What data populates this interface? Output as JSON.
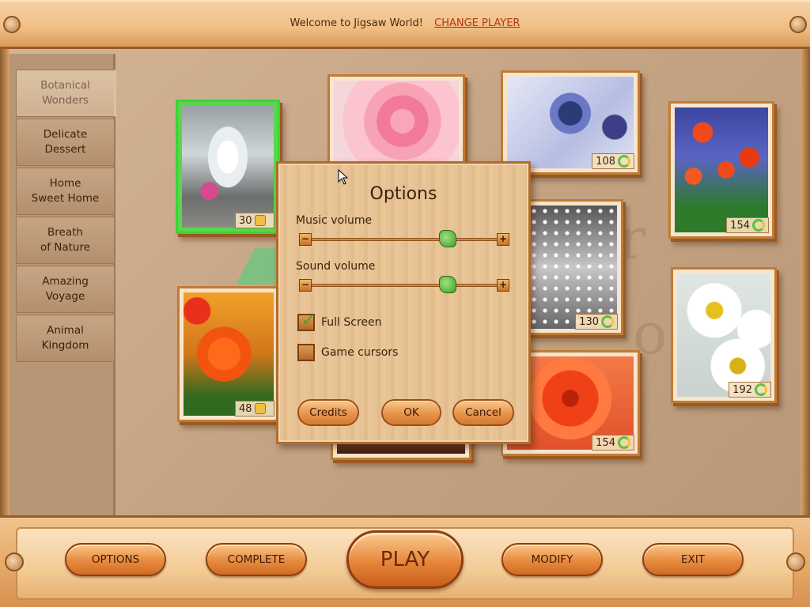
{
  "header": {
    "welcome": "Welcome to Jigsaw World!",
    "change_player": "CHANGE PLAYER"
  },
  "sidebar": {
    "items": [
      {
        "label": "Botanical\nWonders",
        "active": true
      },
      {
        "label": "Delicate\nDessert",
        "active": false
      },
      {
        "label": "Home\nSweet Home",
        "active": false
      },
      {
        "label": "Breath\nof Nature",
        "active": false
      },
      {
        "label": "Amazing\nVoyage",
        "active": false
      },
      {
        "label": "Animal\nKingdom",
        "active": false
      }
    ]
  },
  "puzzles": [
    {
      "id": "floating-candles",
      "pieces": "30",
      "selected": true
    },
    {
      "id": "pink-rose",
      "pieces": "",
      "selected": false
    },
    {
      "id": "blue-thistle",
      "pieces": "108",
      "selected": false
    },
    {
      "id": "red-tulips",
      "pieces": "154",
      "selected": false
    },
    {
      "id": "orange-rose",
      "pieces": "48",
      "selected": false
    },
    {
      "id": "white-blossoms",
      "pieces": "130",
      "selected": false
    },
    {
      "id": "white-daisies",
      "pieces": "192",
      "selected": false
    },
    {
      "id": "red-chrysanthemum",
      "pieces": "154",
      "selected": false
    }
  ],
  "options_dialog": {
    "title": "Options",
    "music_label": "Music volume",
    "music_level": 0.72,
    "sound_label": "Sound volume",
    "sound_level": 0.72,
    "fullscreen_label": "Full Screen",
    "fullscreen_checked": true,
    "cursors_label": "Game cursors",
    "cursors_checked": false,
    "credits_label": "Credits",
    "ok_label": "OK",
    "cancel_label": "Cancel"
  },
  "bottom_bar": {
    "options_label": "OPTIONS",
    "complete_label": "COMPLETE",
    "play_label": "PLAY",
    "modify_label": "MODIFY",
    "exit_label": "EXIT"
  },
  "colors": {
    "accent": "#e8863a",
    "selected_border": "#3bd33b",
    "link": "#b33a14"
  }
}
